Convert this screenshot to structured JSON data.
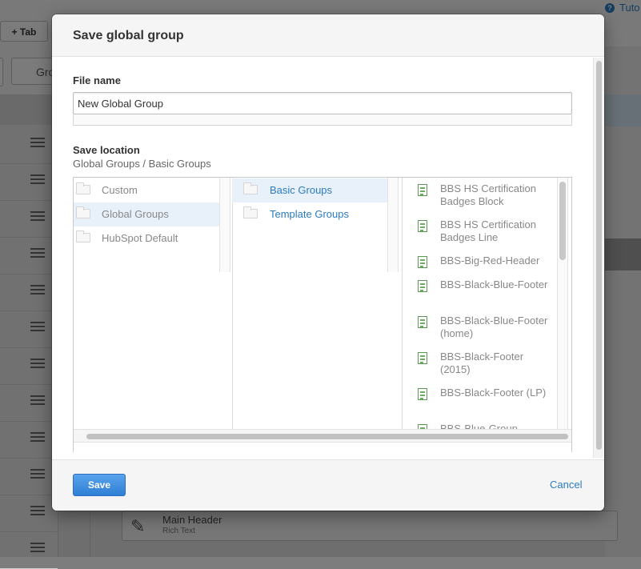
{
  "background": {
    "tab_button": "+ Tab",
    "help_link": "Tuto",
    "group_button": "Gro",
    "main_header": {
      "title": "Main Header",
      "subtitle": "Rich Text"
    }
  },
  "modal": {
    "title": "Save global group",
    "file_name": {
      "label": "File name",
      "value": "New Global Group"
    },
    "save_location": {
      "label": "Save location",
      "path": "Global Groups / Basic Groups",
      "column1": [
        "Custom",
        "Global Groups",
        "HubSpot Default"
      ],
      "column1_selected": 1,
      "column2": [
        "Basic Groups",
        "Template Groups"
      ],
      "column2_selected": 0,
      "column3": [
        "BBS HS Certification Badges Block",
        "BBS HS Certification Badges Line",
        "BBS-Big-Red-Header",
        "BBS-Black-Blue-Footer",
        "BBS-Black-Blue-Footer (home)",
        "BBS-Black-Footer (2015)",
        "BBS-Black-Footer (LP)",
        "BBS-Blue-Group"
      ]
    },
    "save_button": "Save",
    "cancel_link": "Cancel"
  }
}
